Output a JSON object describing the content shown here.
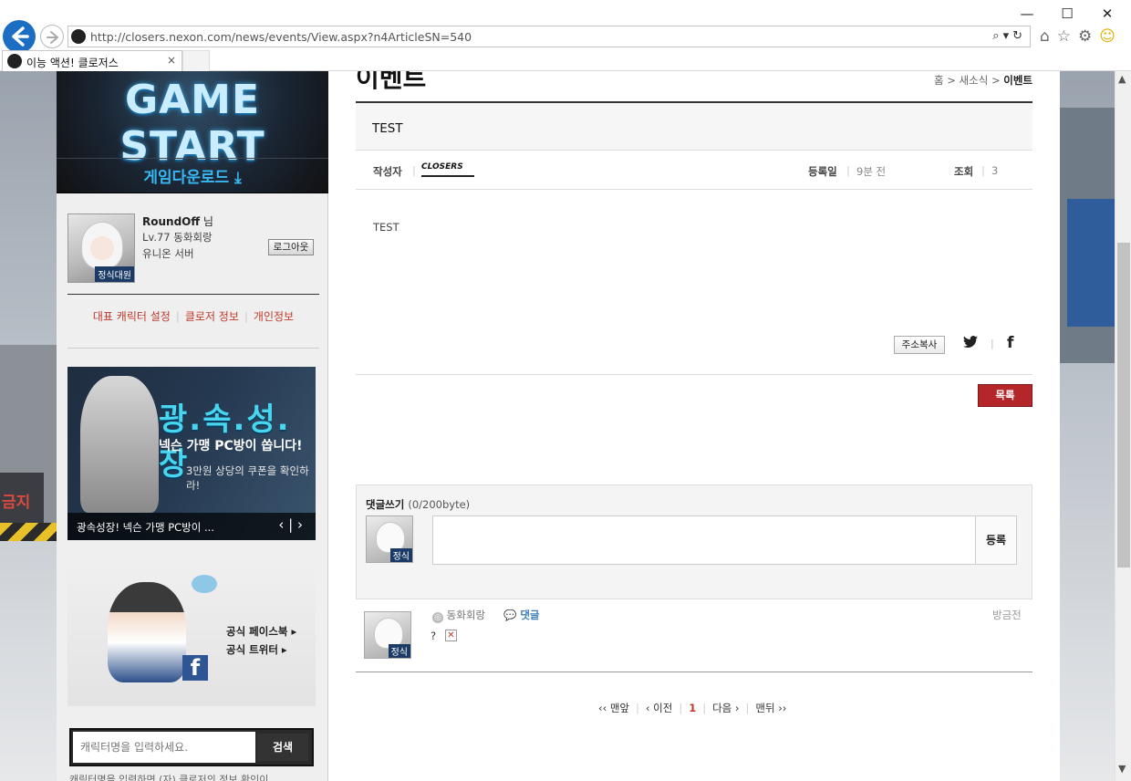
{
  "browser": {
    "url": "http://closers.nexon.com/news/events/View.aspx?n4ArticleSN=540",
    "tab_title": "이능 액션! 클로저스",
    "minimize": "—",
    "maximize": "☐",
    "close": "✕",
    "tab_close": "×"
  },
  "sidebar": {
    "game_start": "GAME START",
    "download": "게임다운로드 ⤓",
    "profile": {
      "name": "RoundOff",
      "honorific": "님",
      "level": "Lv.77 동화회랑",
      "server": "유니온 서버",
      "badge": "정식대원",
      "logout": "로그아웃"
    },
    "links": [
      "대표 캐릭터 설정",
      "클로저 정보",
      "개인정보"
    ],
    "banner": {
      "title": "광.속.성.장",
      "subtitle": "넥슨 가맹 PC방이 쏩니다!",
      "coupon": "3만원 상당의 쿠폰을 확인하라!",
      "caption": "광속성장! 넥슨 가맹 PC방이 ...",
      "nav": "‹ | ›"
    },
    "social": {
      "facebook": "공식 페이스북 ▸",
      "twitter": "공식 트위터 ▸"
    },
    "search": {
      "placeholder": "캐릭터명을 입력하세요.",
      "button": "검색",
      "hint": "캐릭터명을 입력하면 (자) 클로저의 정보 확인이 ..."
    }
  },
  "content": {
    "page_title": "이벤트",
    "breadcrumb": {
      "home": "홈",
      "news": "새소식",
      "current": "이벤트"
    },
    "article": {
      "title": "TEST",
      "author_label": "작성자",
      "author_logo": "CLOSERS",
      "date_label": "등록일",
      "date_value": "9분 전",
      "views_label": "조회",
      "views_value": "3",
      "body": "TEST"
    },
    "copy_address": "주소복사",
    "list_button": "목록",
    "comment_form": {
      "title": "댓글쓰기",
      "counter": "(0/200byte)",
      "submit": "등록",
      "badge": "정식"
    },
    "comment": {
      "author": "동화회랑",
      "reply": "댓글",
      "time": "방금전",
      "text": "?",
      "badge": "정식",
      "level_icon": "◎",
      "delete": "✕"
    },
    "pager": {
      "first": "‹‹ 맨앞",
      "prev": "‹ 이전",
      "current": "1",
      "next": "다음 ›",
      "last": "맨뒤 ››"
    }
  },
  "scrollbar": {
    "up": "▲",
    "down": "▼"
  }
}
